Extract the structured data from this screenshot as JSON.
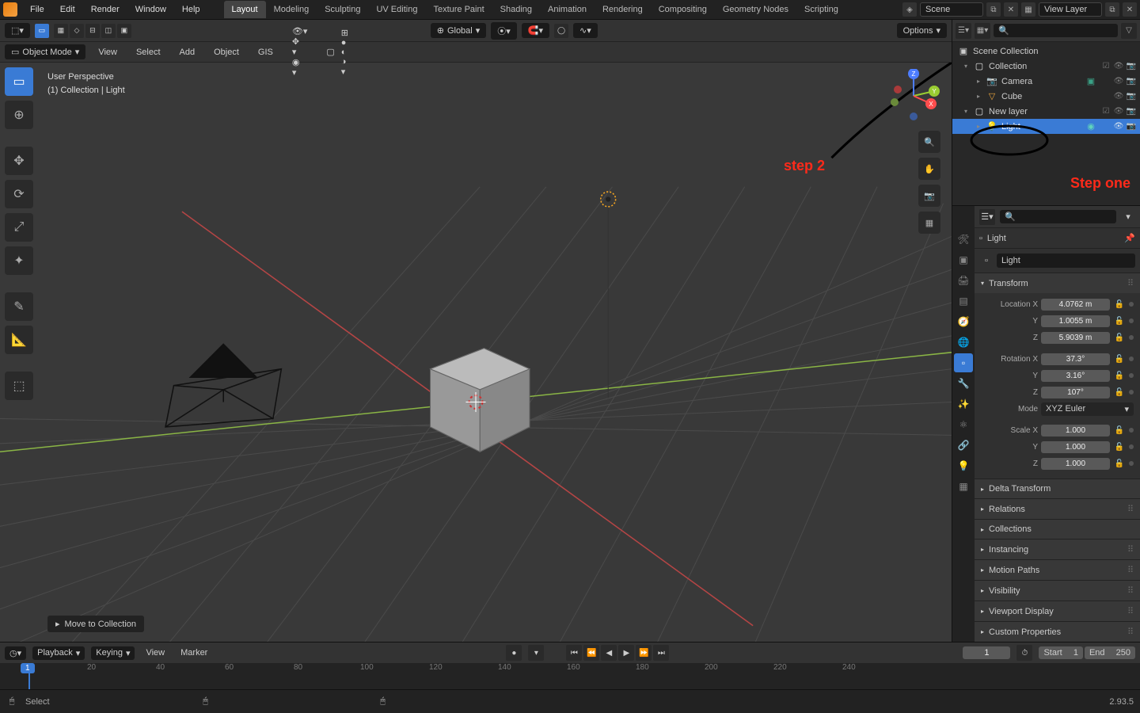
{
  "top_menu": {
    "file": "File",
    "edit": "Edit",
    "render": "Render",
    "window": "Window",
    "help": "Help"
  },
  "workspaces": [
    "Layout",
    "Modeling",
    "Sculpting",
    "UV Editing",
    "Texture Paint",
    "Shading",
    "Animation",
    "Rendering",
    "Compositing",
    "Geometry Nodes",
    "Scripting"
  ],
  "active_workspace": "Layout",
  "scene_field": "Scene",
  "viewlayer_field": "View Layer",
  "viewport": {
    "orientation": "Global",
    "mode": "Object Mode",
    "menus": [
      "View",
      "Select",
      "Add",
      "Object",
      "GIS"
    ],
    "info_line1": "User Perspective",
    "info_line2": "(1) Collection | Light",
    "options_btn": "Options",
    "hint": "Move to Collection"
  },
  "outliner": {
    "root": "Scene Collection",
    "items": [
      {
        "name": "Collection",
        "type": "collection",
        "selected": false,
        "depth": 1,
        "expanded": true
      },
      {
        "name": "Camera",
        "type": "camera",
        "selected": false,
        "depth": 2,
        "expanded": false,
        "badge": true
      },
      {
        "name": "Cube",
        "type": "mesh",
        "selected": false,
        "depth": 2,
        "expanded": false
      },
      {
        "name": "New layer",
        "type": "collection",
        "selected": false,
        "depth": 1,
        "expanded": true
      },
      {
        "name": "Light",
        "type": "light",
        "selected": true,
        "depth": 2,
        "expanded": false,
        "badge": true
      }
    ]
  },
  "properties": {
    "breadcrumb": "Light",
    "name": "Light",
    "transform": {
      "loc": {
        "xlabel": "Location X",
        "ylabel": "Y",
        "zlabel": "Z",
        "x": "4.0762 m",
        "y": "1.0055 m",
        "z": "5.9039 m"
      },
      "rot": {
        "xlabel": "Rotation X",
        "ylabel": "Y",
        "zlabel": "Z",
        "x": "37.3°",
        "y": "3.16°",
        "z": "107°"
      },
      "mode_label": "Mode",
      "mode": "XYZ Euler",
      "scale": {
        "xlabel": "Scale X",
        "ylabel": "Y",
        "zlabel": "Z",
        "x": "1.000",
        "y": "1.000",
        "z": "1.000"
      }
    },
    "panels": [
      "Transform",
      "Delta Transform",
      "Relations",
      "Collections",
      "Instancing",
      "Motion Paths",
      "Visibility",
      "Viewport Display",
      "Custom Properties"
    ]
  },
  "timeline": {
    "playback": "Playback",
    "keying": "Keying",
    "view": "View",
    "marker": "Marker",
    "current": "1",
    "start_label": "Start",
    "start": "1",
    "end_label": "End",
    "end": "250",
    "ticks": [
      "20",
      "40",
      "60",
      "80",
      "100",
      "120",
      "140",
      "160",
      "180",
      "200",
      "220",
      "240"
    ]
  },
  "statusbar": {
    "select": "Select",
    "version": "2.93.5"
  },
  "annotations": {
    "step_one": "Step one",
    "step_two": "step 2"
  }
}
